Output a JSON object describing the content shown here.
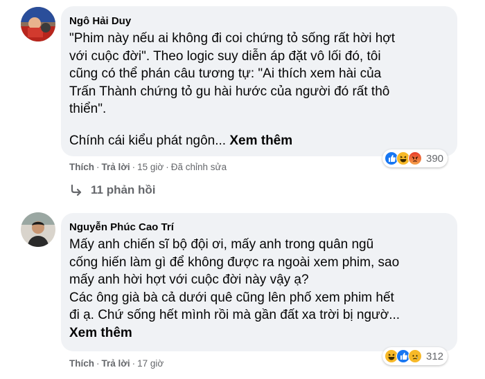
{
  "comments": [
    {
      "author": "Ngô Hải Duy",
      "lines": [
        "\"Phim này nếu ai không đi coi chứng tỏ sống rất hời hợt",
        "với cuộc đời\". Theo logic suy diễn áp đặt vô lối đó, tôi",
        "cũng có thể phán câu tương tự: \"Ai thích xem hài của",
        "Trấn Thành chứng tỏ gu hài hước của người đó rất thô",
        "thiển\"."
      ],
      "truncated_text": "Chính cái kiểu phát ngôn...",
      "see_more": "Xem thêm",
      "reaction_count": "390",
      "reactions": [
        "like-icon",
        "haha-icon",
        "angry-icon"
      ],
      "like_label": "Thích",
      "reply_label": "Trả lời",
      "time": "15 giờ",
      "edited": "Đã chỉnh sửa",
      "replies_label": "11 phản hồi",
      "avatar_colors": [
        "#b8251d",
        "#2a4e9a",
        "#e8b38d"
      ]
    },
    {
      "author": "Nguyễn Phúc Cao Trí",
      "lines": [
        "Mấy anh chiến sĩ bộ đội ơi, mấy anh trong quân ngũ",
        "cống hiến làm gì để không được ra ngoài xem phim, sao",
        "mấy anh hời hợt với cuộc đời này vậy ạ?",
        "Các ông già bà cả dưới quê cũng lên phố xem phim hết",
        "đi ạ. Chứ sống hết mình rồi mà gần đất xa trời bị ngườ..."
      ],
      "see_more": "Xem thêm",
      "reaction_count": "312",
      "reactions": [
        "haha-icon",
        "like-icon",
        "sad-icon"
      ],
      "like_label": "Thích",
      "reply_label": "Trả lời",
      "time": "17 giờ",
      "avatar_colors": [
        "#d9d4cc",
        "#2b2b2b",
        "#c89672"
      ]
    }
  ],
  "colors": {
    "bubble": "#f0f2f5",
    "meta_text": "#65676b",
    "like_blue": "#1877f2",
    "haha_yellow": "#f7b928",
    "angry_red": "#e9710f"
  }
}
